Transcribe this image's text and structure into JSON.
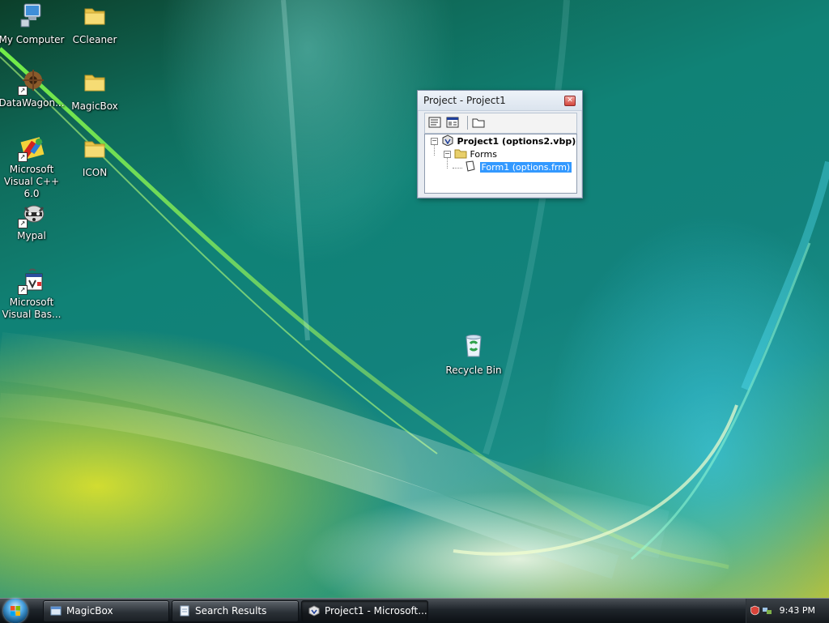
{
  "desktop": {
    "icons": [
      {
        "label": "My Computer",
        "icon": "my-computer-icon"
      },
      {
        "label": "CCleaner",
        "icon": "folder-icon"
      },
      {
        "label": "DataWagon...",
        "icon": "datawagon-icon"
      },
      {
        "label": "MagicBox",
        "icon": "folder-icon"
      },
      {
        "label": "Microsoft\nVisual C++ 6.0",
        "icon": "visual-cpp-icon"
      },
      {
        "label": "ICON",
        "icon": "folder-icon"
      },
      {
        "label": "Mypal",
        "icon": "mypal-raccoon-icon"
      },
      {
        "label": "Microsoft\nVisual Bas...",
        "icon": "visual-basic-icon"
      },
      {
        "label": "Recycle Bin",
        "icon": "recycle-bin-icon"
      }
    ]
  },
  "project_window": {
    "title": "Project - Project1",
    "toolbar": [
      "view-code-icon",
      "view-object-icon",
      "toggle-folders-icon"
    ],
    "tree": {
      "project": "Project1 (options2.vbp)",
      "folder": "Forms",
      "form": "Form1 (options.frm)"
    }
  },
  "taskbar": {
    "buttons": [
      {
        "label": "MagicBox",
        "icon": "window-icon"
      },
      {
        "label": "Search Results",
        "icon": "document-icon"
      },
      {
        "label": "Project1 - Microsoft...",
        "icon": "vb-project-icon"
      }
    ],
    "clock": "9:43 PM"
  },
  "colors": {
    "selection": "#3399ff",
    "taskbar": "#1f252b"
  }
}
